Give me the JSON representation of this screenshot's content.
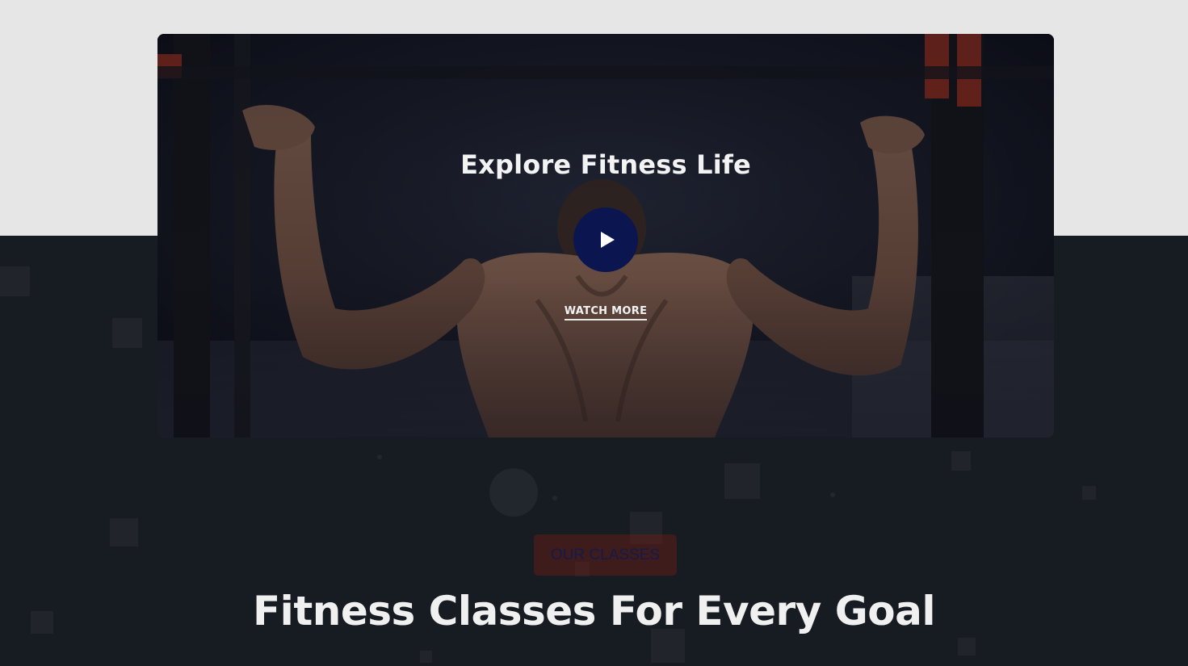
{
  "video": {
    "title": "Explore Fitness Life",
    "play_icon": "play-icon",
    "watch_more_label": "WATCH MORE"
  },
  "classes": {
    "badge": "OUR CLASSES",
    "heading": "Fitness Classes For Every Goal"
  },
  "colors": {
    "top_band": "#e6e6e6",
    "dark_section": "#171b22",
    "play_button": "#0b1650",
    "badge_text": "#141a4c"
  }
}
